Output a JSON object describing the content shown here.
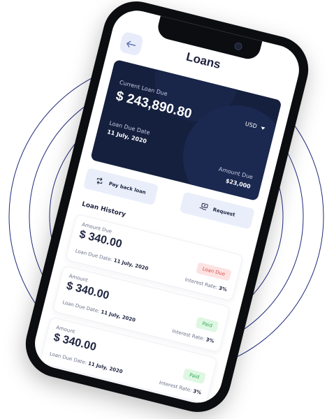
{
  "header": {
    "title": "Loans"
  },
  "card": {
    "current_label": "Current Loan Due",
    "current_amount": "$ 243,890.80",
    "currency": "USD",
    "due_label": "Loan Due Date",
    "due_date": "11 July, 2020",
    "amount_label": "Amount Due",
    "amount_value": "$23,000"
  },
  "actions": {
    "pay_back": "Pay back loan",
    "request": "Request"
  },
  "history": {
    "title": "Loan History",
    "items": [
      {
        "amount_label": "Amount Due",
        "amount": "$ 340.00",
        "date_label": "Loan Due Date:",
        "date": "11 July, 2020",
        "status": "Loan Due",
        "rate_label": "Interest Rate:",
        "rate": "3%"
      },
      {
        "amount_label": "Amount",
        "amount": "$ 340.00",
        "date_label": "Loan Due Date:",
        "date": "11 July, 2020",
        "status": "Paid",
        "rate_label": "Interest Rate:",
        "rate": "3%"
      },
      {
        "amount_label": "Amount",
        "amount": "$ 340.00",
        "date_label": "Loan Due Date:",
        "date": "11 July, 2020",
        "status": "Paid",
        "rate_label": "Interest Rate:",
        "rate": "3%"
      }
    ]
  },
  "colors": {
    "accent": "#15203e",
    "badge_due_bg": "#fde2e2",
    "badge_due_text": "#e04a4a",
    "badge_paid_bg": "#def7e3",
    "badge_paid_text": "#32a852",
    "rings": "#1f2a7a"
  }
}
